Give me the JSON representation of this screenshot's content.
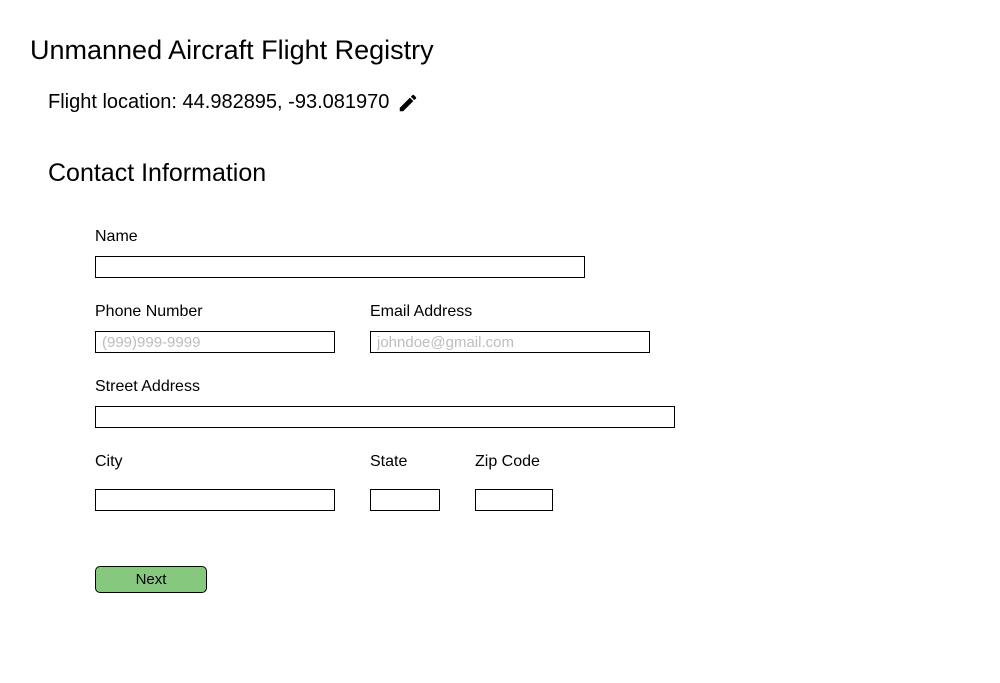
{
  "header": {
    "title": "Unmanned Aircraft Flight Registry",
    "flight_location_label": "Flight location: ",
    "flight_location_value": "44.982895, -93.081970"
  },
  "section": {
    "title": "Contact Information"
  },
  "form": {
    "name": {
      "label": "Name",
      "value": "",
      "placeholder": ""
    },
    "phone": {
      "label": "Phone Number",
      "value": "",
      "placeholder": "(999)999-9999"
    },
    "email": {
      "label": "Email Address",
      "value": "",
      "placeholder": "johndoe@gmail.com"
    },
    "street": {
      "label": "Street Address",
      "value": "",
      "placeholder": ""
    },
    "city": {
      "label": "City",
      "value": "",
      "placeholder": ""
    },
    "state": {
      "label": "State",
      "value": "",
      "placeholder": ""
    },
    "zip": {
      "label": "Zip Code",
      "value": "",
      "placeholder": ""
    }
  },
  "buttons": {
    "next_label": "Next"
  }
}
